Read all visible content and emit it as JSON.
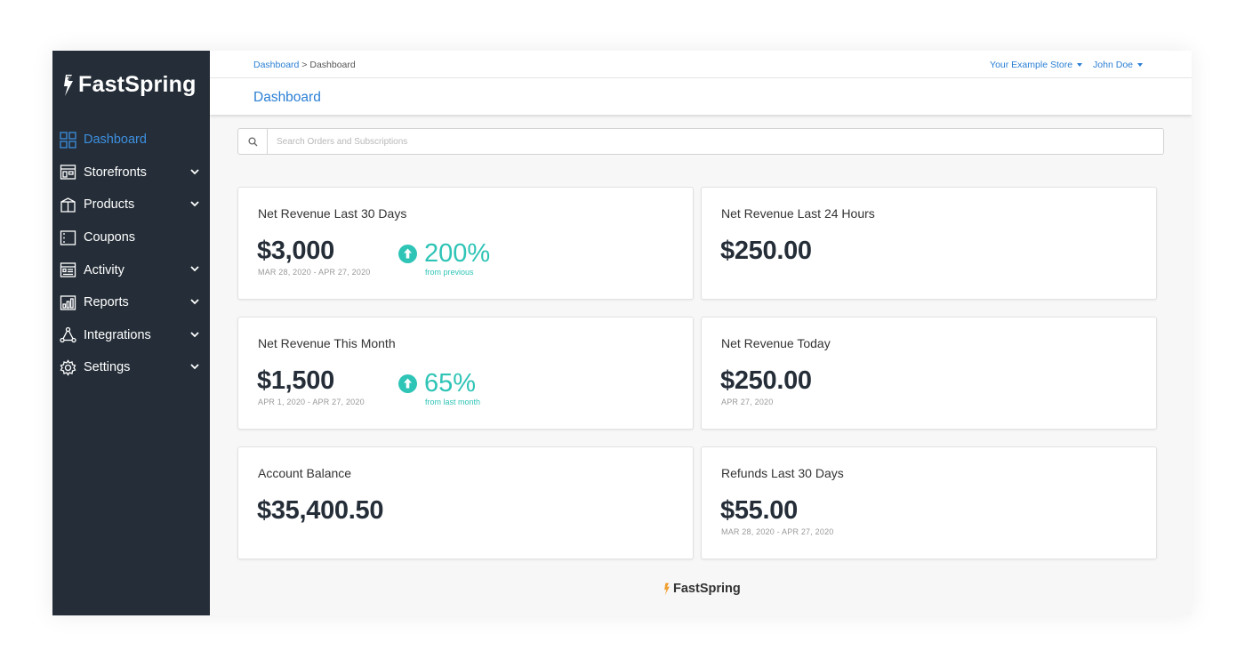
{
  "brand": {
    "name": "FastSpring",
    "accent": "#f0a030"
  },
  "sidebar": {
    "items": [
      {
        "label": "Dashboard",
        "icon": "grid-icon",
        "active": true,
        "expandable": false
      },
      {
        "label": "Storefronts",
        "icon": "storefront-icon",
        "active": false,
        "expandable": true
      },
      {
        "label": "Products",
        "icon": "box-icon",
        "active": false,
        "expandable": true
      },
      {
        "label": "Coupons",
        "icon": "coupon-icon",
        "active": false,
        "expandable": false
      },
      {
        "label": "Activity",
        "icon": "activity-icon",
        "active": false,
        "expandable": true
      },
      {
        "label": "Reports",
        "icon": "reports-icon",
        "active": false,
        "expandable": true
      },
      {
        "label": "Integrations",
        "icon": "integrations-icon",
        "active": false,
        "expandable": true
      },
      {
        "label": "Settings",
        "icon": "gear-icon",
        "active": false,
        "expandable": true
      }
    ]
  },
  "header": {
    "breadcrumb_link": "Dashboard",
    "breadcrumb_separator": ">",
    "breadcrumb_current": "Dashboard",
    "store_selector": "Your Example Store",
    "user_menu": "John Doe",
    "page_title": "Dashboard"
  },
  "search": {
    "placeholder": "Search Orders and Subscriptions",
    "value": ""
  },
  "cards": {
    "revenue_30d": {
      "title": "Net Revenue Last 30 Days",
      "value": "$3,000",
      "range": "MAR 28, 2020 - APR 27, 2020",
      "trend_pct": "200%",
      "trend_note": "from previous"
    },
    "revenue_24h": {
      "title": "Net Revenue Last 24 Hours",
      "value": "$250.00"
    },
    "revenue_month": {
      "title": "Net Revenue This Month",
      "value": "$1,500",
      "range": "APR 1, 2020 - APR 27, 2020",
      "trend_pct": "65%",
      "trend_note": "from last month"
    },
    "revenue_today": {
      "title": "Net Revenue Today",
      "value": "$250.00",
      "range": "APR 27, 2020"
    },
    "balance": {
      "title": "Account Balance",
      "value": "$35,400.50"
    },
    "refunds_30d": {
      "title": "Refunds Last 30 Days",
      "value": "$55.00",
      "range": "MAR 28, 2020 - APR 27, 2020"
    }
  },
  "footer": {
    "brand": "FastSpring"
  },
  "colors": {
    "sidebar_bg": "#252e38",
    "link_blue": "#2a7fd4",
    "trend_teal": "#2ec4b6",
    "active_nav": "#3d8fe0"
  }
}
